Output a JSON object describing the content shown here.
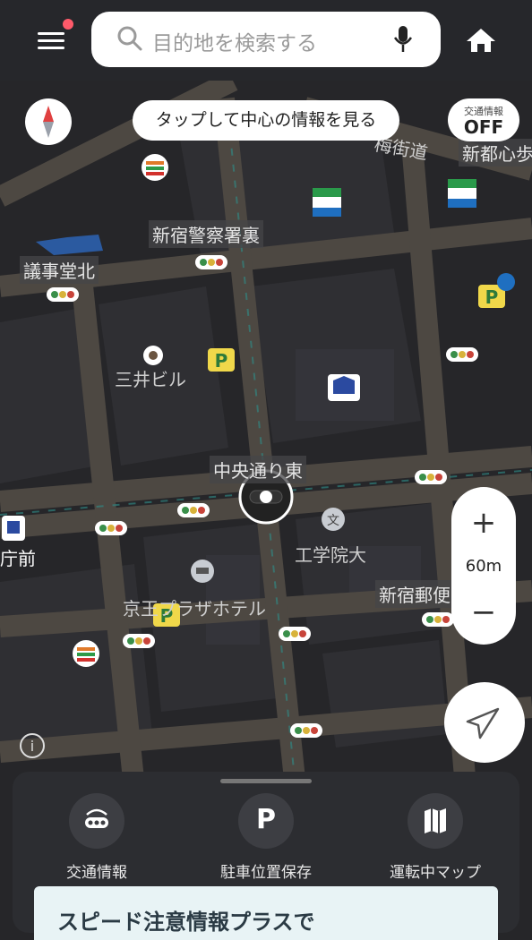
{
  "search": {
    "placeholder": "目的地を検索する",
    "icon": "search-icon",
    "mic_icon": "microphone-icon"
  },
  "header": {
    "menu_icon": "hamburger-menu-icon",
    "home_icon": "home-icon",
    "notification": true
  },
  "overlay": {
    "tap_hint": "タップして中心の情報を見る",
    "traffic_toggle": {
      "title": "交通情報",
      "state": "OFF"
    }
  },
  "map": {
    "labels": [
      {
        "text": "新宿警察署裏",
        "style": "boxed"
      },
      {
        "text": "議事堂北",
        "style": "boxed"
      },
      {
        "text": "三井ビル",
        "style": "plain"
      },
      {
        "text": "中央通り東",
        "style": "boxed"
      },
      {
        "text": "工学院大",
        "style": "plain"
      },
      {
        "text": "京王プラザホテル",
        "style": "plain"
      },
      {
        "text": "新宿郵便",
        "style": "boxed"
      },
      {
        "text": "新都心歩",
        "style": "boxed"
      },
      {
        "text": "梅街道",
        "style": "plain"
      },
      {
        "text": "庁前",
        "style": "plain"
      }
    ],
    "poi_icons": [
      "seven-eleven-icon",
      "familymart-icon",
      "parking-icon",
      "airport-parking-icon",
      "bank-icon",
      "school-icon",
      "hotel-icon",
      "bus-stop-icon",
      "traffic-light-icon"
    ],
    "colors": {
      "background": "#262629",
      "road": "#56504a",
      "accent": "#2f8f8a",
      "parking": "#f0d84a"
    }
  },
  "zoom": {
    "plus": "+",
    "minus": "−",
    "scale": "60m"
  },
  "bottom_sheet": {
    "actions": [
      {
        "label": "交通情報",
        "icon": "traffic-signal-icon"
      },
      {
        "label": "P",
        "icon": "parking-icon"
      },
      {
        "label": "駐車位置保存",
        "icon": ""
      },
      {
        "label": "運転中マップ",
        "icon": "map-icon"
      }
    ],
    "labels": [
      "交通情報",
      "駐車位置保存",
      "運転中マップ"
    ],
    "parking_letter": "P",
    "promo_text": "スピード注意情報プラスで"
  }
}
